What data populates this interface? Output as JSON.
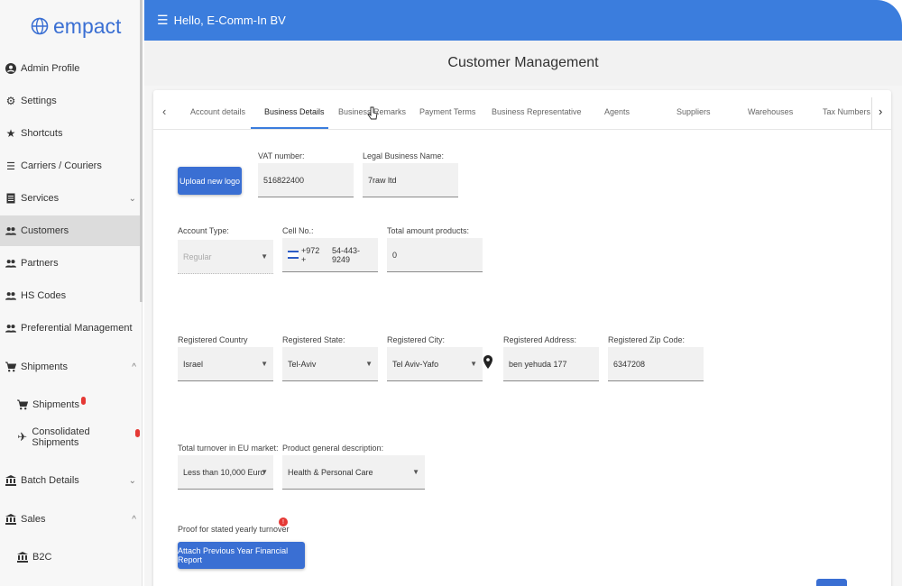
{
  "app": {
    "logo_text": "empact",
    "greeting": "Hello, E-Comm-In BV",
    "page_title": "Customer Management"
  },
  "sidebar": {
    "items": [
      {
        "label": "Admin Profile",
        "icon": "account-circle-icon"
      },
      {
        "label": "Settings",
        "icon": "gear-icon"
      },
      {
        "label": "Shortcuts",
        "icon": "star-icon"
      },
      {
        "label": "Carriers / Couriers",
        "icon": "list-icon"
      },
      {
        "label": "Services",
        "icon": "document-icon",
        "chevron": "⌄"
      },
      {
        "label": "Customers",
        "icon": "people-icon",
        "active": true
      },
      {
        "label": "Partners",
        "icon": "people-icon"
      },
      {
        "label": "HS Codes",
        "icon": "people-icon"
      },
      {
        "label": "Preferential Management",
        "icon": "people-icon"
      },
      {
        "label": "Shipments",
        "icon": "cart-icon",
        "chevron": "^"
      },
      {
        "label": "Shipments",
        "icon": "cart-icon",
        "sub": true
      },
      {
        "label": "Consolidated Shipments",
        "icon": "airplane-icon",
        "sub": true
      },
      {
        "label": "Batch Details",
        "icon": "bank-icon",
        "chevron": "⌄"
      },
      {
        "label": "Sales",
        "icon": "bank-icon",
        "chevron": "^"
      },
      {
        "label": "B2C",
        "icon": "bank-icon",
        "sub": true
      }
    ]
  },
  "tabs": [
    {
      "label": "Account details"
    },
    {
      "label": "Business Details",
      "active": true
    },
    {
      "label": "Business Remarks"
    },
    {
      "label": "Payment Terms"
    },
    {
      "label": "Business Representative"
    },
    {
      "label": "Agents"
    },
    {
      "label": "Suppliers"
    },
    {
      "label": "Warehouses"
    },
    {
      "label": "Tax Numbers"
    }
  ],
  "form": {
    "upload_logo_label": "Upload new logo",
    "vat_label": "VAT number:",
    "vat_value": "516822400",
    "legal_name_label": "Legal Business Name:",
    "legal_name_value": "7raw ltd",
    "account_type_label": "Account Type:",
    "account_type_value": "Regular",
    "cell_label": "Cell No.:",
    "cell_prefix": "+972 +",
    "cell_value": "54-443-9249",
    "total_products_label": "Total amount products:",
    "total_products_value": "0",
    "country_label": "Registered Country",
    "country_value": "Israel",
    "state_label": "Registered State:",
    "state_value": "Tel-Aviv",
    "city_label": "Registered City:",
    "city_value": "Tel Aviv-Yafo",
    "address_label": "Registered Address:",
    "address_value": "ben yehuda 177",
    "zip_label": "Registered Zip Code:",
    "zip_value": "6347208",
    "turnover_label": "Total turnover in EU market:",
    "turnover_value": "Less than 10,000 Euro",
    "product_desc_label": "Product general description:",
    "product_desc_value": "Health & Personal Care",
    "proof_label": "Proof for stated yearly turnover",
    "attach_label": "Attach Previous Year Financial Report"
  },
  "colors": {
    "brand": "#3b7ddd",
    "button": "#3a6fd3",
    "alert": "#e53935"
  }
}
